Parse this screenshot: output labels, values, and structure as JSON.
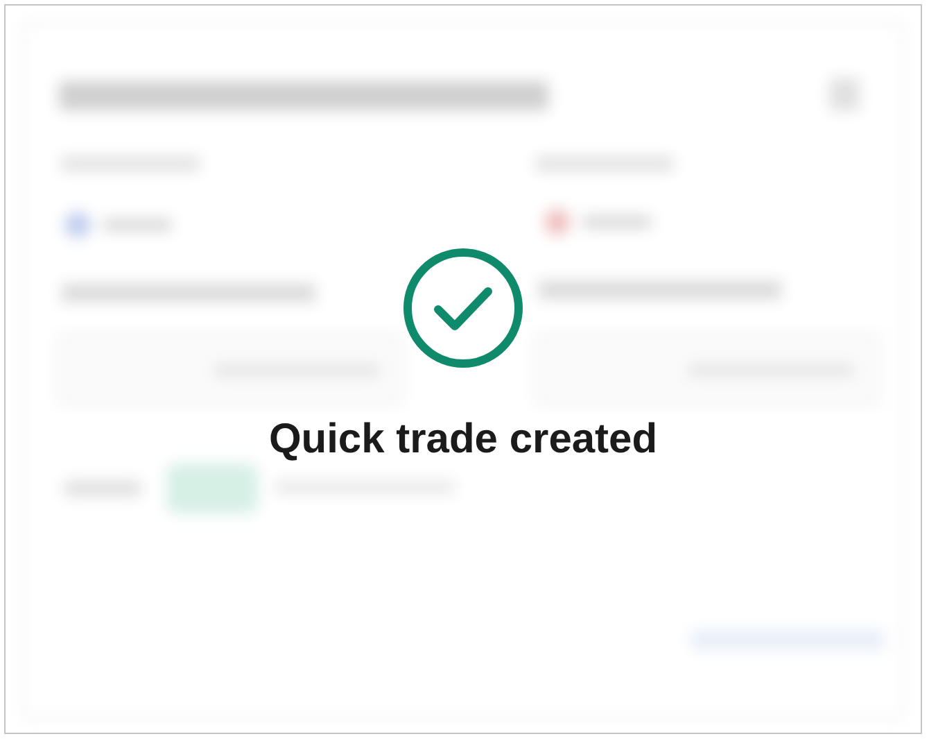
{
  "message": {
    "text": "Quick trade created",
    "kind": "success"
  }
}
